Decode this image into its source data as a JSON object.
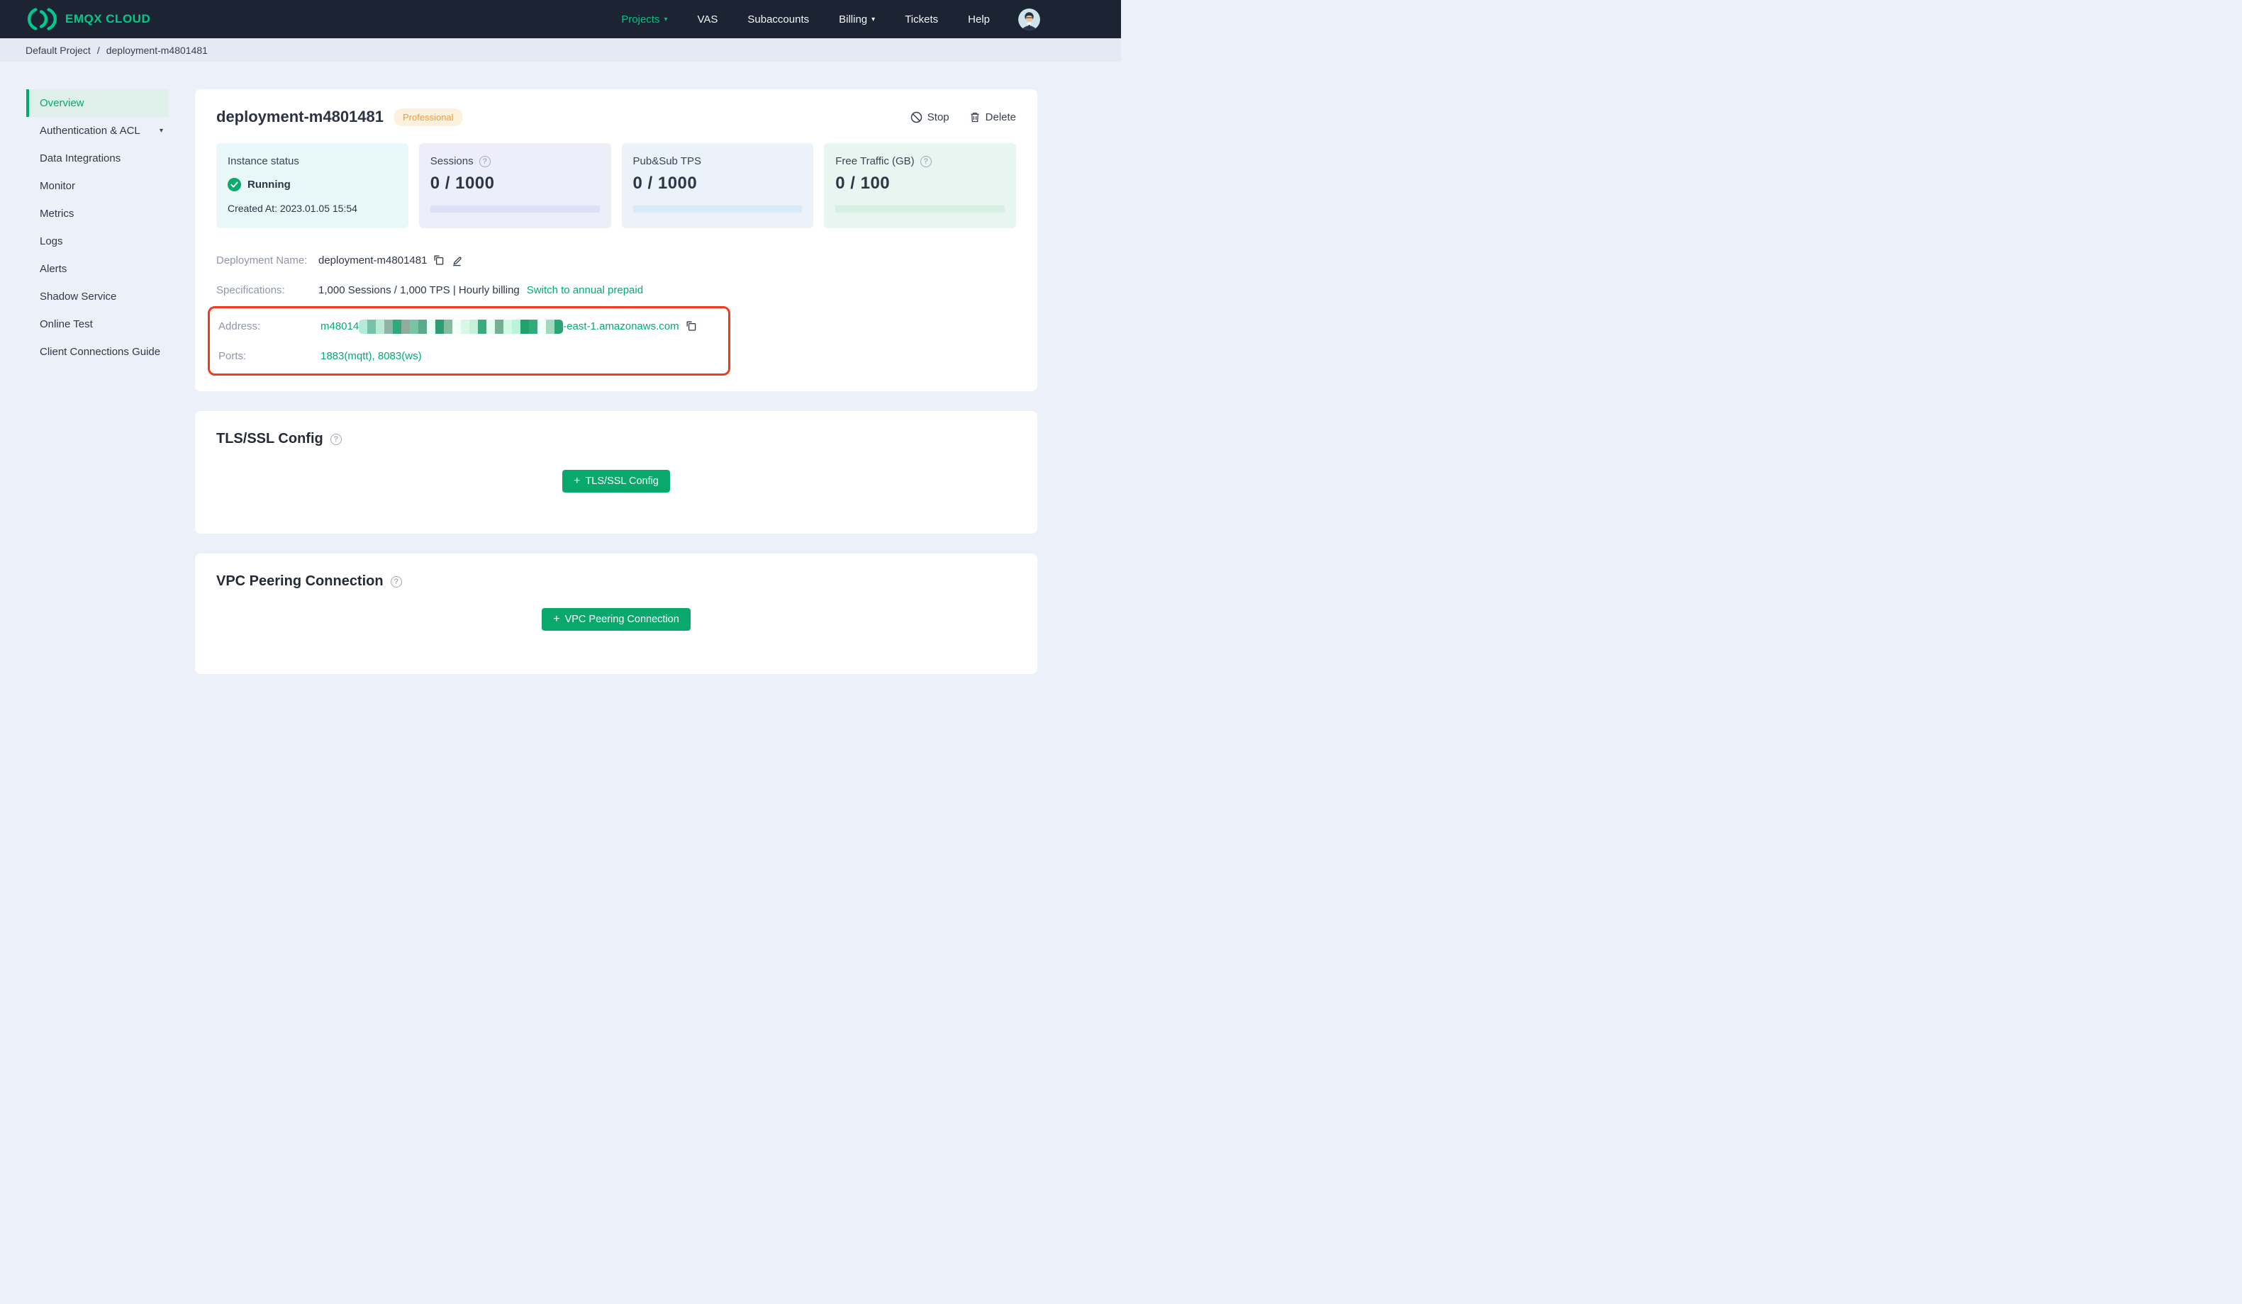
{
  "colors": {
    "nav_bg": "#1c2333",
    "page_bg": "#ecf0f8",
    "breadcrumb_bg": "#e5e9f4",
    "brand_green": "#00c98b",
    "accent_green": "#00ad71",
    "button_green": "#09a86d",
    "badge_text": "#ef9d3c",
    "badge_bg": "#fcf1dc",
    "annotation_red": "#f5391d",
    "stat_instance_bg": "#e8f8f8",
    "stat_sessions_bg": "#eceffa",
    "stat_tps_bg": "#ebf2fa",
    "stat_traffic_bg": "#e7f6f0"
  },
  "glyphs": {
    "caret": "▾",
    "question": "?",
    "plus": "+"
  },
  "nav": {
    "brand": "EMQX CLOUD",
    "items": [
      {
        "label": "Projects",
        "caret": true,
        "active": true
      },
      {
        "label": "VAS"
      },
      {
        "label": "Subaccounts"
      },
      {
        "label": "Billing",
        "caret": true
      },
      {
        "label": "Tickets"
      },
      {
        "label": "Help"
      }
    ]
  },
  "breadcrumb": {
    "parent": "Default Project",
    "separator": "/",
    "current": "deployment-m4801481"
  },
  "sidebar": {
    "items": [
      {
        "label": "Overview",
        "active": true
      },
      {
        "label": "Authentication & ACL",
        "caret": true
      },
      {
        "label": "Data Integrations"
      },
      {
        "label": "Monitor"
      },
      {
        "label": "Metrics"
      },
      {
        "label": "Logs"
      },
      {
        "label": "Alerts"
      },
      {
        "label": "Shadow Service"
      },
      {
        "label": "Online Test"
      },
      {
        "label": "Client Connections Guide"
      }
    ]
  },
  "overview": {
    "title": "deployment-m4801481",
    "badge": "Professional",
    "stop_label": "Stop",
    "delete_label": "Delete",
    "stats": {
      "instance": {
        "label": "Instance status",
        "status": "Running",
        "created": "Created At: 2023.01.05 15:54"
      },
      "sessions": {
        "label": "Sessions",
        "value": "0 / 1000"
      },
      "tps": {
        "label": "Pub&Sub TPS",
        "value": "0 / 1000"
      },
      "traffic": {
        "label": "Free Traffic (GB)",
        "value": "0 / 100"
      }
    },
    "details": {
      "name_label": "Deployment Name:",
      "name_value": "deployment-m4801481",
      "spec_label": "Specifications:",
      "spec_value": "1,000 Sessions / 1,000 TPS | Hourly billing",
      "spec_link": "Switch to annual prepaid",
      "address_label": "Address:",
      "address_prefix": "m48014",
      "address_suffix": "-east-1.amazonaws.com",
      "address_redacted_colors": [
        "#b2ebd8",
        "#74c2a7",
        "#b9ead6",
        "#8fb3a5",
        "#2fa87b",
        "#93ab9e",
        "#79c4a4",
        "#5aab89",
        "#eafff7",
        "#2d9e73",
        "#85bb9e",
        "#f2fff9",
        "#d9f7e7",
        "#c5f0da",
        "#3aaa80",
        "#e2fdf0",
        "#75b093",
        "#d2f8e6",
        "#baf2dc",
        "#20a26d",
        "#32aa79",
        "#effffa",
        "#a3d8c0",
        "#2ba474"
      ],
      "ports_label": "Ports:",
      "ports_value": "1883(mqtt), 8083(ws)"
    }
  },
  "tls": {
    "title": "TLS/SSL Config",
    "button": "TLS/SSL Config"
  },
  "vpc": {
    "title": "VPC Peering Connection",
    "button": "VPC Peering Connection"
  }
}
